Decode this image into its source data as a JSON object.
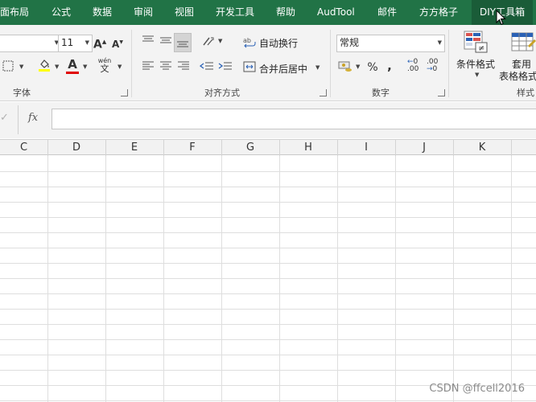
{
  "menu": {
    "tabs": [
      "面布局",
      "公式",
      "数据",
      "审阅",
      "视图",
      "开发工具",
      "帮助",
      "AudTool",
      "邮件",
      "方方格子",
      "DIY工具箱"
    ],
    "active_tab": "DIY工具箱"
  },
  "ribbon": {
    "font": {
      "size_value": "11",
      "grow_label": "A",
      "shrink_label": "A",
      "font_color_label": "A",
      "phonetic_top": "wén",
      "phonetic_bottom": "文",
      "group_label": "字体",
      "fill_color": "#ffff00",
      "font_color": "#e00000"
    },
    "alignment": {
      "wrap_text_label": "自动换行",
      "merge_center_label": "合并后居中",
      "group_label": "对齐方式"
    },
    "number": {
      "format_value": "常规",
      "percent_label": "%",
      "comma_label": ",",
      "increase_decimal_label": ".00",
      "decrease_decimal_label": ".00",
      "group_label": "数字"
    },
    "styles": {
      "conditional_format_label": "条件格式",
      "table_format_label_line1": "套用",
      "table_format_label_line2": "表格格式",
      "group_label": "样式"
    }
  },
  "formula_bar": {
    "check_icon": "✓",
    "fx_label": "fx",
    "value": ""
  },
  "grid": {
    "columns": [
      "C",
      "D",
      "E",
      "F",
      "G",
      "H",
      "I",
      "J",
      "K"
    ]
  },
  "watermark": "CSDN @ffcell2016",
  "colors": {
    "menu_bg": "#217346",
    "active_tab_bg": "#1a5c38",
    "ribbon_bg": "#f3f3f3"
  }
}
